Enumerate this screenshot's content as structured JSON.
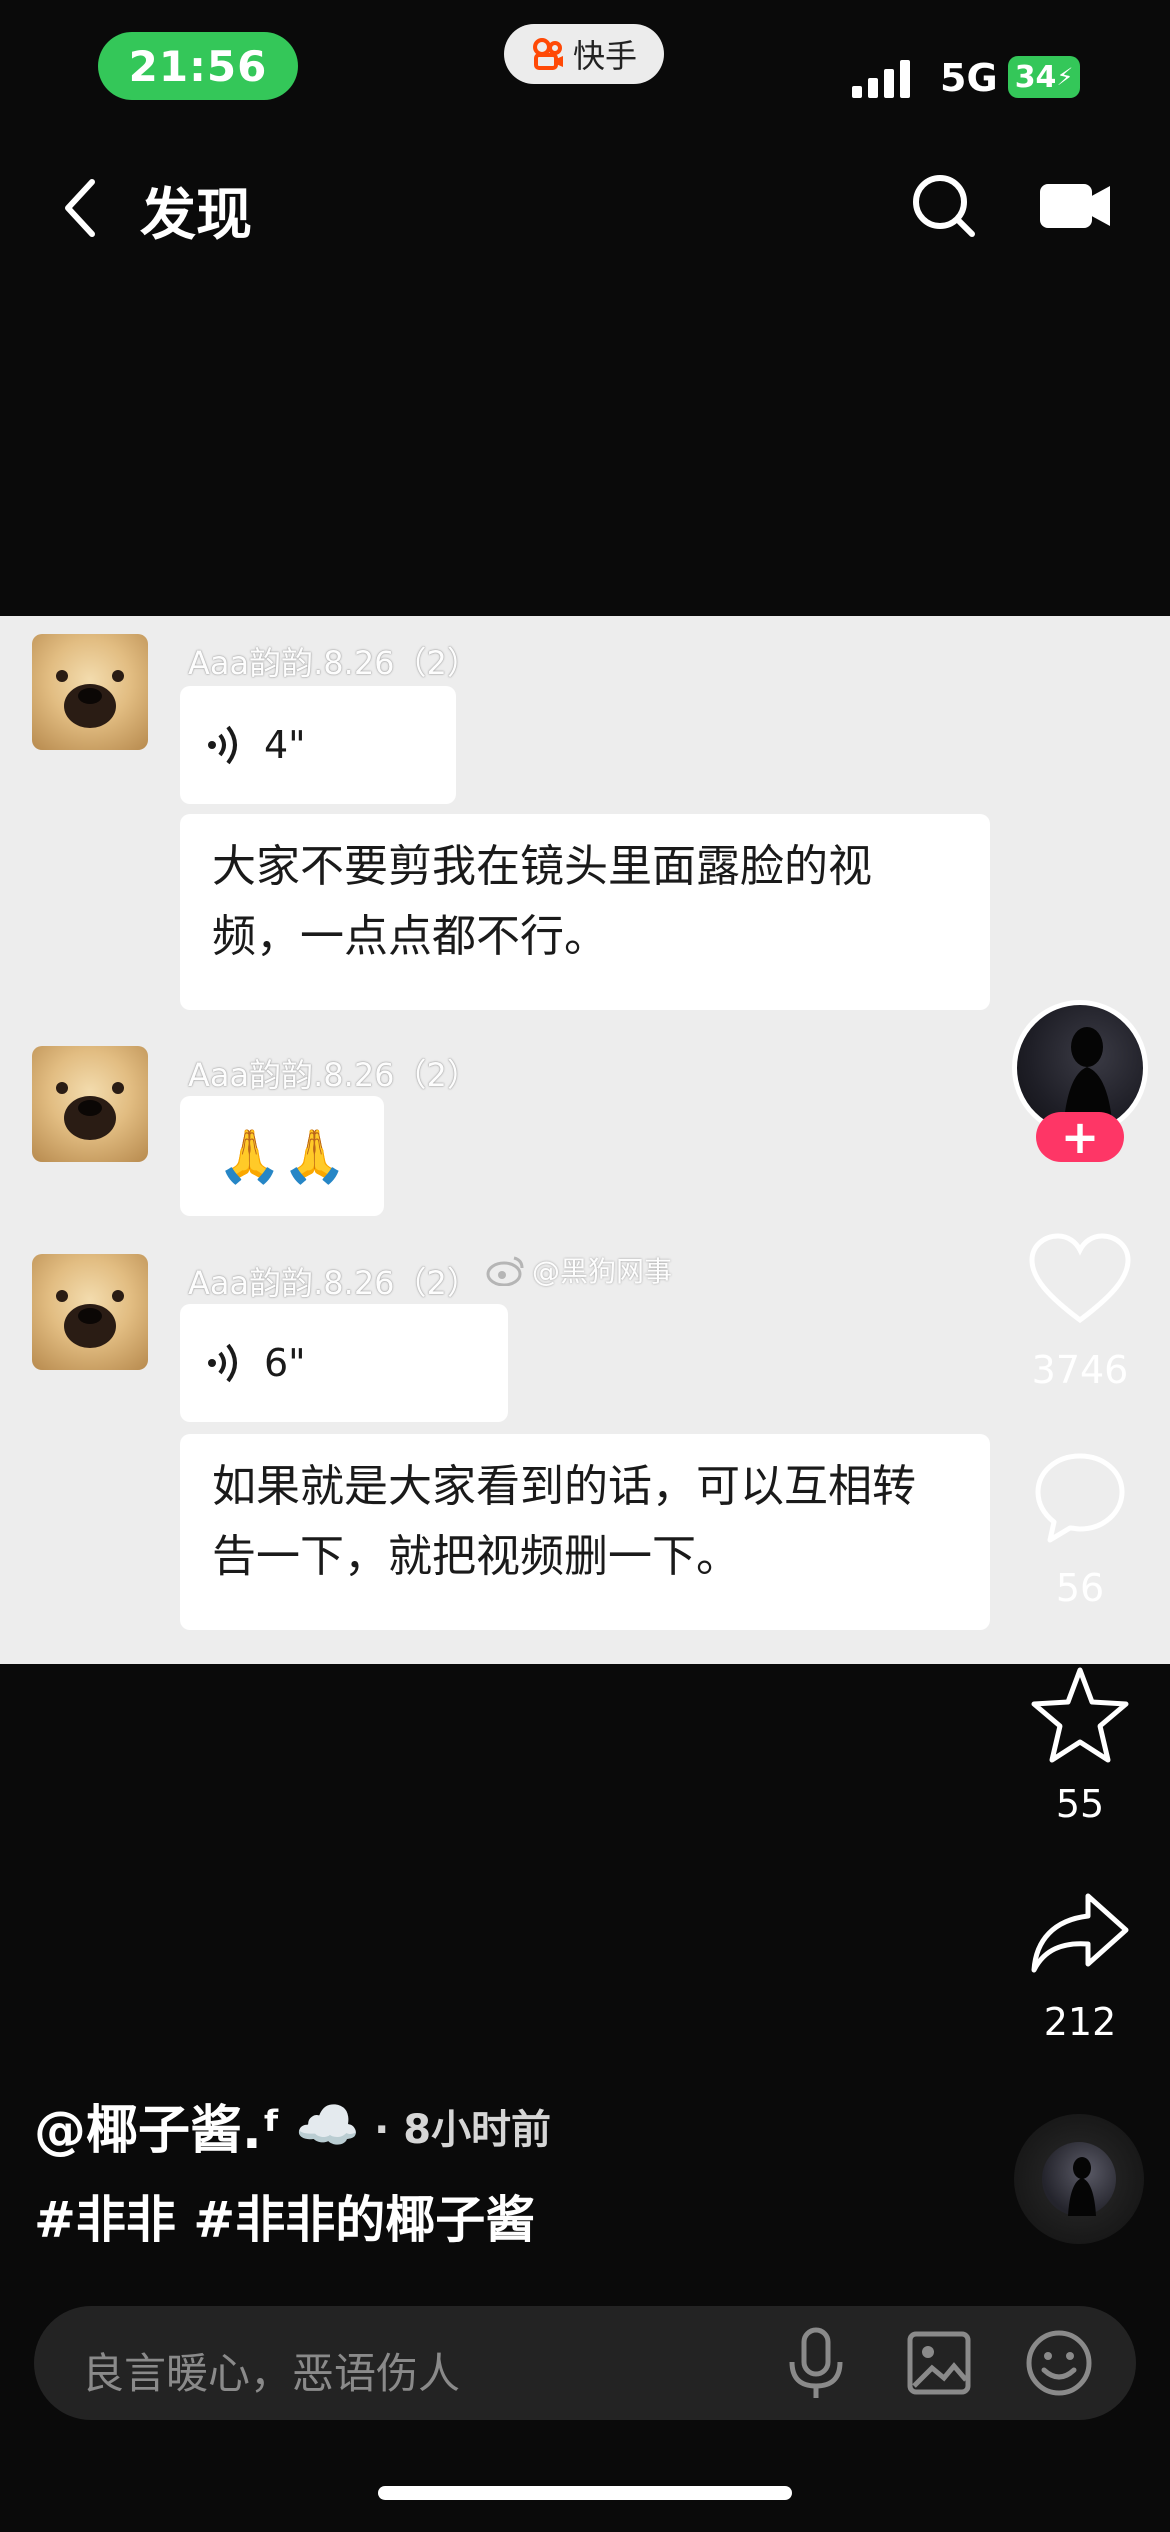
{
  "status_bar": {
    "time": "21:56",
    "app_name": "快手",
    "network": "5G",
    "battery": "34"
  },
  "nav": {
    "title": "发现"
  },
  "chat": {
    "messages": [
      {
        "sender": "Aaa韵韵.8.26（2）",
        "voice_duration": "4\"",
        "text": "大家不要剪我在镜头里面露脸的视频，一点点都不行。"
      },
      {
        "sender": "Aaa韵韵.8.26（2）",
        "emoji": "🙏🙏"
      },
      {
        "sender": "Aaa韵韵.8.26（2）",
        "voice_duration": "6\"",
        "text": "如果就是大家看到的话，可以互相转告一下，就把视频删一下。"
      }
    ],
    "watermark": "@黑狗网事"
  },
  "rail": {
    "follow_symbol": "+",
    "likes": "3746",
    "comments": "56",
    "favorites": "55",
    "shares": "212"
  },
  "post": {
    "author": "@椰子酱.ᶠ",
    "author_emoji": "☁️",
    "time_ago": "· 8小时前",
    "tags": "#非非 #非非的椰子酱"
  },
  "comment_bar": {
    "placeholder": "良言暖心，恶语伤人"
  },
  "icons": [
    "back-icon",
    "search-icon",
    "camera-icon",
    "voice-wave-icon",
    "heart-icon",
    "comment-icon",
    "star-icon",
    "share-icon",
    "mic-icon",
    "image-icon",
    "emoji-icon",
    "music-disc-icon",
    "weibo-icon"
  ]
}
